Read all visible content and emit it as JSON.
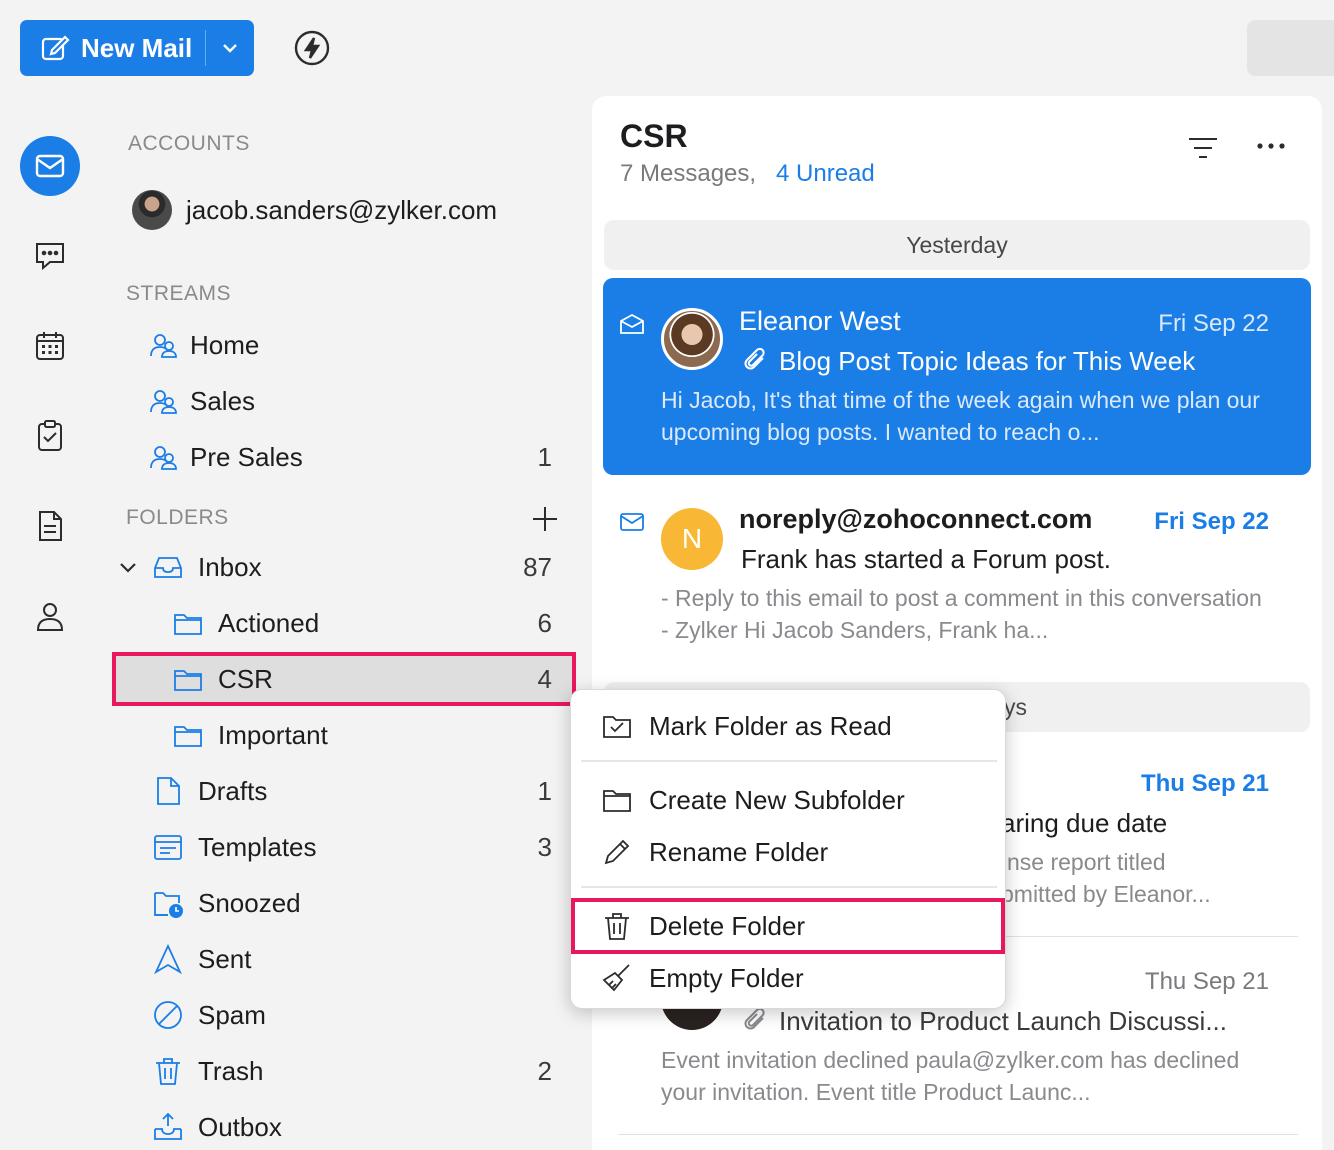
{
  "toolbar": {
    "new_mail_label": "New Mail",
    "new_mail_icon": "compose-icon",
    "dropdown_icon": "chevron-down-icon",
    "quick_action_icon": "lightning-icon"
  },
  "rail": {
    "items": [
      {
        "name": "mail",
        "icon": "mail-icon",
        "active": true
      },
      {
        "name": "chat",
        "icon": "chat-icon",
        "active": false
      },
      {
        "name": "calendar",
        "icon": "calendar-icon",
        "active": false
      },
      {
        "name": "tasks",
        "icon": "tasks-icon",
        "active": false
      },
      {
        "name": "notes",
        "icon": "notes-icon",
        "active": false
      },
      {
        "name": "contacts",
        "icon": "contacts-icon",
        "active": false
      }
    ]
  },
  "sidebar": {
    "accounts_title": "ACCOUNTS",
    "account_email": "jacob.sanders@zylker.com",
    "streams_title": "STREAMS",
    "streams": [
      {
        "label": "Home",
        "count": ""
      },
      {
        "label": "Sales",
        "count": ""
      },
      {
        "label": "Pre Sales",
        "count": "1"
      }
    ],
    "folders_title": "FOLDERS",
    "folders": [
      {
        "label": "Inbox",
        "count": "87",
        "icon": "inbox-icon"
      },
      {
        "label": "Actioned",
        "count": "6",
        "icon": "folder-icon"
      },
      {
        "label": "CSR",
        "count": "4",
        "icon": "folder-icon",
        "selected": true
      },
      {
        "label": "Important",
        "count": "",
        "icon": "folder-icon"
      },
      {
        "label": "Drafts",
        "count": "1",
        "icon": "drafts-icon"
      },
      {
        "label": "Templates",
        "count": "3",
        "icon": "templates-icon"
      },
      {
        "label": "Snoozed",
        "count": "",
        "icon": "snoozed-icon"
      },
      {
        "label": "Sent",
        "count": "",
        "icon": "sent-icon"
      },
      {
        "label": "Spam",
        "count": "",
        "icon": "spam-icon"
      },
      {
        "label": "Trash",
        "count": "2",
        "icon": "trash-icon"
      },
      {
        "label": "Outbox",
        "count": "",
        "icon": "outbox-icon"
      }
    ]
  },
  "list": {
    "title": "CSR",
    "summary": "7 Messages,",
    "unread": "4 Unread",
    "date_groups": [
      "Yesterday",
      "ys"
    ],
    "messages": [
      {
        "sender": "Eleanor West",
        "date": "Fri Sep 22",
        "subject": "Blog Post Topic Ideas for This Week",
        "preview": "Hi Jacob, It's that time of the week again when we plan our upcoming blog posts. I wanted to reach o...",
        "selected": true,
        "attachment": true
      },
      {
        "sender": "noreply@zohoconnect.com",
        "avatar_letter": "N",
        "date": "Fri Sep 22",
        "subject": "Frank has started a Forum post.",
        "preview": "- Reply to this email to post a comment in this conversation - Zylker Hi Jacob Sanders, Frank ha...",
        "unread": true
      },
      {
        "date": "Thu Sep 21",
        "subject_partial": "aring due date",
        "preview_line1": "nse report titled",
        "preview_line2": "bmitted by Eleanor...",
        "unread": true
      },
      {
        "date": "Thu Sep 21",
        "subject": "Invitation to Product Launch Discussi...",
        "preview": "Event invitation declined paula@zylker.com has declined your invitation. Event title Product Launc...",
        "attachment": true
      }
    ]
  },
  "context_menu": {
    "items": [
      {
        "label": "Mark Folder as Read",
        "icon": "mark-read-icon"
      },
      {
        "label": "Create New Subfolder",
        "icon": "folder-icon"
      },
      {
        "label": "Rename Folder",
        "icon": "pencil-icon"
      },
      {
        "label": "Delete Folder",
        "icon": "trash-icon",
        "highlighted": true
      },
      {
        "label": "Empty Folder",
        "icon": "broom-icon"
      }
    ]
  },
  "colors": {
    "accent": "#1a7ee6",
    "highlight_border": "#e8185d",
    "avatar_orange": "#f8b836"
  }
}
